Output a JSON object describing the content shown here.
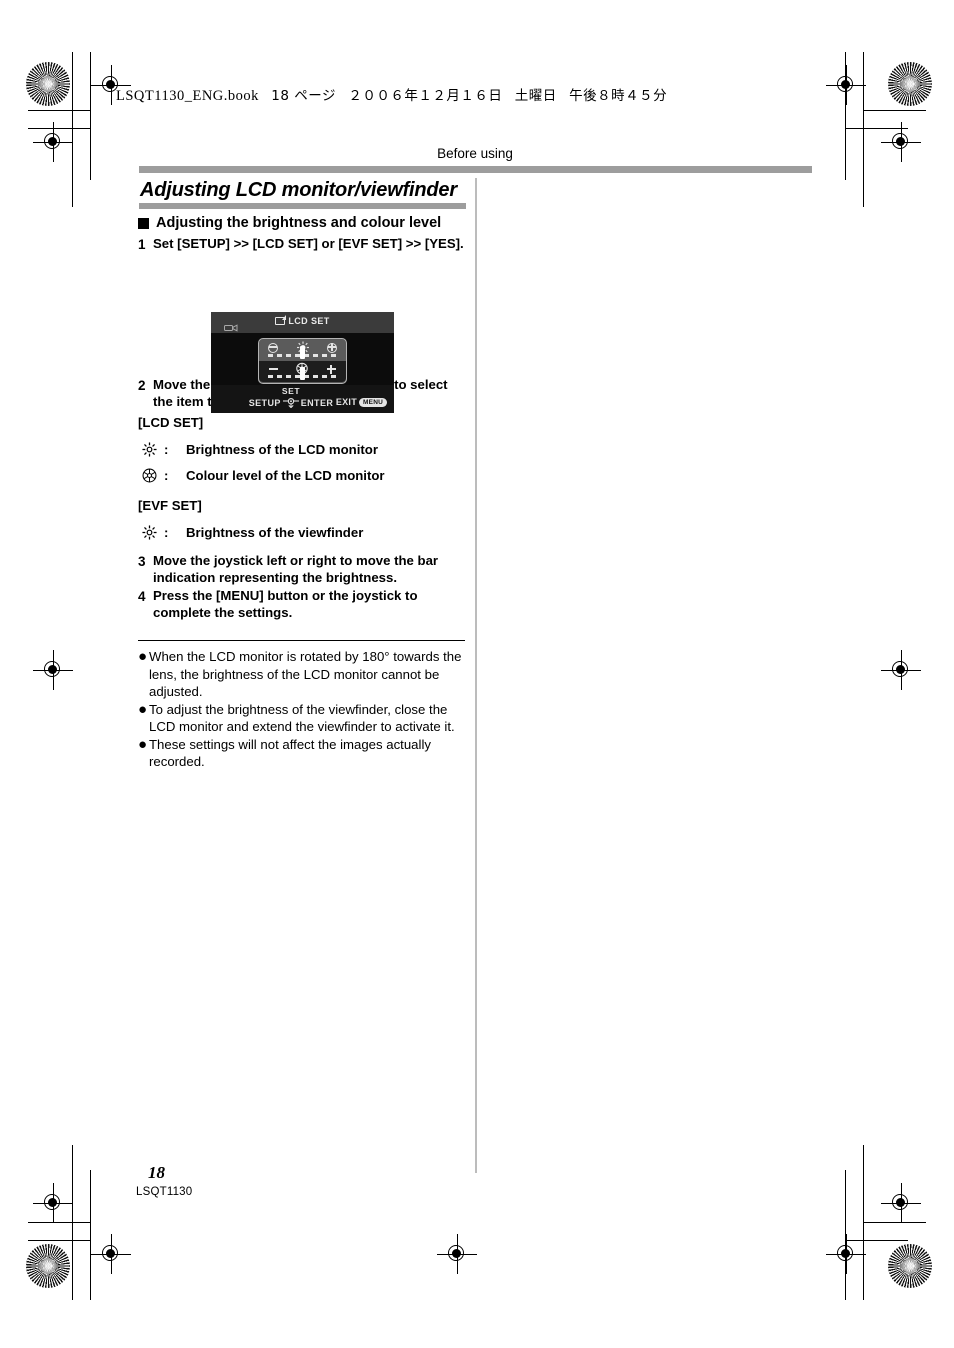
{
  "print_header": {
    "filename": "LSQT1130_ENG.book",
    "page_label": "18 ページ",
    "date": "２００６年１２月１６日",
    "weekday": "土曜日",
    "time": "午後８時４５分"
  },
  "running_head": "Before using",
  "chapter_title": "Adjusting LCD monitor/viewfinder",
  "subsection": {
    "heading": "Adjusting the brightness and colour level"
  },
  "steps": [
    {
      "num": "1",
      "text": "Set [SETUP] >> [LCD SET] or [EVF SET] >> [YES]."
    },
    {
      "num": "2",
      "text": "Move the joystick up or down in order to select the item to be adjusted."
    },
    {
      "num": "3",
      "text": "Move the joystick left or right to move the bar indication representing the brightness."
    },
    {
      "num": "4",
      "text": "Press the [MENU] button or the joystick to complete the settings."
    }
  ],
  "lcd_set": {
    "label": "[LCD SET]",
    "items": [
      {
        "icon": "brightness-sun-icon",
        "colon": ":",
        "text": "Brightness of the LCD monitor"
      },
      {
        "icon": "colour-level-icon",
        "colon": ":",
        "text": "Colour level of the LCD monitor"
      }
    ]
  },
  "evf_set": {
    "label": "[EVF SET]",
    "items": [
      {
        "icon": "brightness-sun-icon",
        "colon": ":",
        "text": "Brightness of the viewfinder"
      }
    ]
  },
  "notes": [
    "When the LCD monitor is rotated by 180° towards the lens, the brightness of the LCD monitor cannot be adjusted.",
    "To adjust the brightness of the viewfinder, close the LCD monitor and extend the viewfinder to activate it.",
    "These settings will not affect the images actually recorded."
  ],
  "note_bullet_glyph": "●",
  "lcd_screenshot": {
    "title": "LCD SET",
    "set_label": "SET",
    "setup_label": "SETUP",
    "enter_label": "ENTER",
    "exit_label": "EXIT",
    "menu_button_label": "MENU",
    "slider_top_minus": "−",
    "slider_top_plus": "+",
    "slider_bottom_minus": "−",
    "slider_bottom_plus": "+"
  },
  "footer": {
    "page_number": "18",
    "part_number": "LSQT1130"
  },
  "colors": {
    "rule_gray": "#9d9d9d",
    "divider_gray": "#bcbcbc",
    "lcd_background": "#0c0c0c",
    "lcd_header": "#3b3b3b",
    "lcd_panel": "#5b5b5b"
  }
}
